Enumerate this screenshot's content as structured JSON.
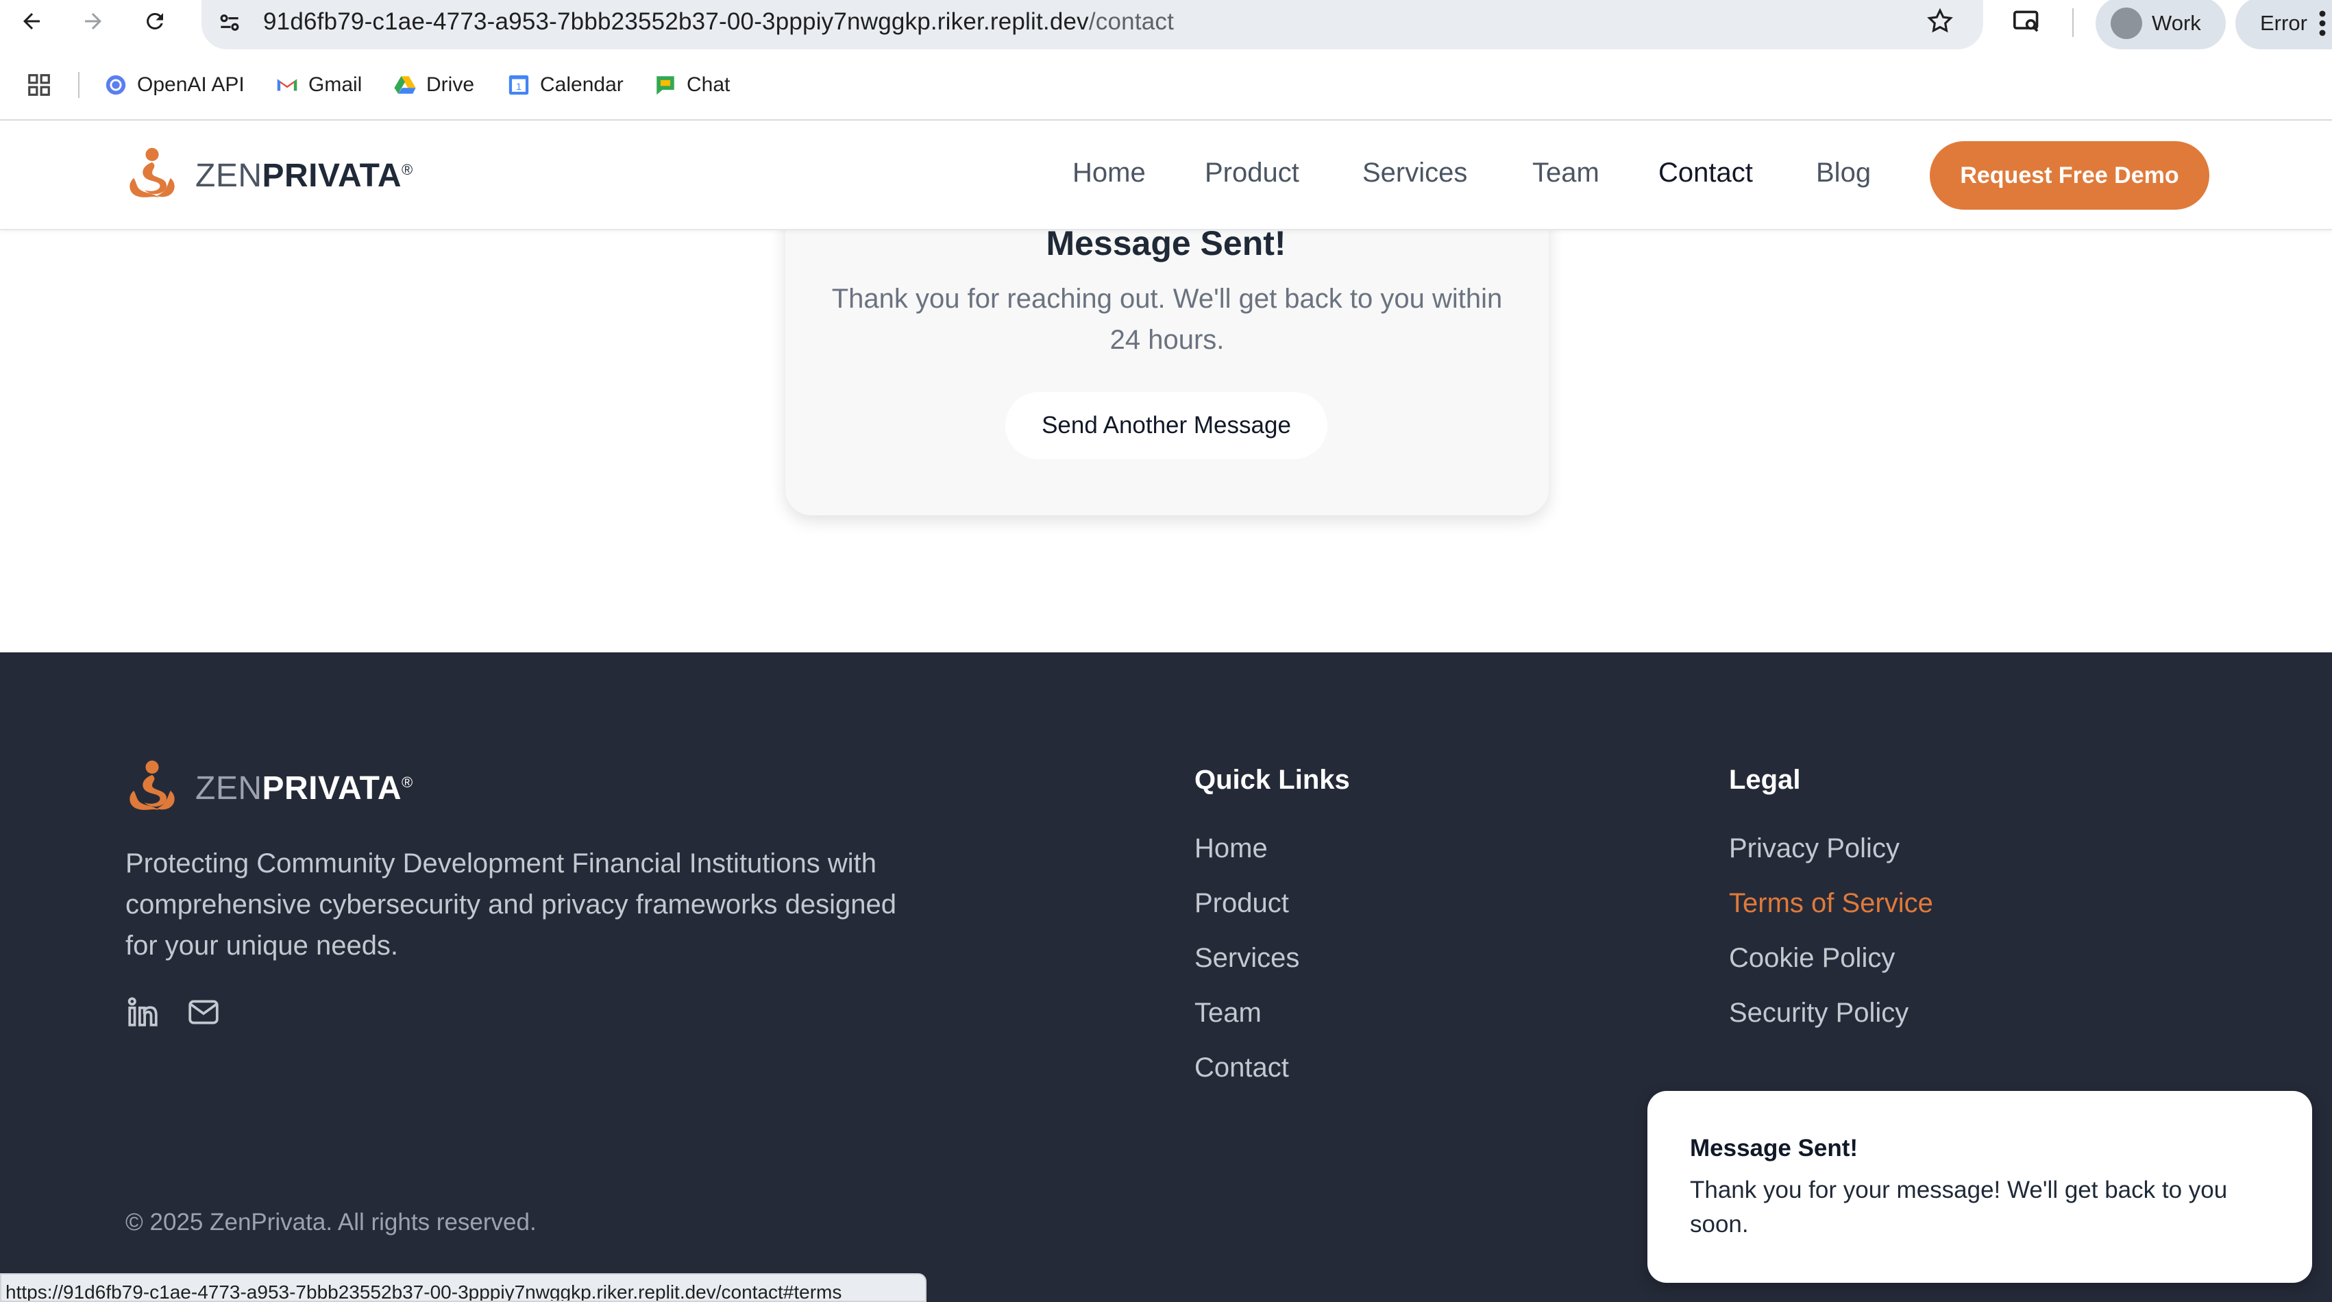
{
  "browser": {
    "url_host": "91d6fb79-c1ae-4773-a953-7bbb23552b37-00-3pppiy7nwggkp.riker.replit.dev",
    "url_path": "/contact",
    "profile_label": "Work",
    "error_label": "Error",
    "bookmarks": [
      {
        "label": "OpenAI API",
        "icon": "openai-icon"
      },
      {
        "label": "Gmail",
        "icon": "gmail-icon"
      },
      {
        "label": "Drive",
        "icon": "drive-icon"
      },
      {
        "label": "Calendar",
        "icon": "calendar-icon"
      },
      {
        "label": "Chat",
        "icon": "chat-icon"
      }
    ],
    "status_url": "https://91d6fb79-c1ae-4773-a953-7bbb23552b37-00-3pppiy7nwggkp.riker.replit.dev/contact#terms"
  },
  "brand": {
    "zen": "ZEN",
    "privata": "PRIVATA",
    "reg": "®",
    "accent": "#e07a3a"
  },
  "nav": {
    "items": [
      {
        "label": "Home"
      },
      {
        "label": "Product"
      },
      {
        "label": "Services"
      },
      {
        "label": "Team"
      },
      {
        "label": "Contact"
      },
      {
        "label": "Blog"
      }
    ],
    "cta": "Request Free Demo"
  },
  "confirmation": {
    "title": "Message Sent!",
    "description": "Thank you for reaching out. We'll get back to you within 24 hours.",
    "button": "Send Another Message"
  },
  "footer": {
    "description": "Protecting Community Development Financial Institutions with comprehensive cybersecurity and privacy frameworks designed for your unique needs.",
    "quick_links_heading": "Quick Links",
    "quick_links": [
      "Home",
      "Product",
      "Services",
      "Team",
      "Contact"
    ],
    "legal_heading": "Legal",
    "legal_links": [
      "Privacy Policy",
      "Terms of Service",
      "Cookie Policy",
      "Security Policy"
    ],
    "copyright": "© 2025 ZenPrivata. All rights reserved."
  },
  "toast": {
    "title": "Message Sent!",
    "body": "Thank you for your message! We'll get back to you soon."
  }
}
